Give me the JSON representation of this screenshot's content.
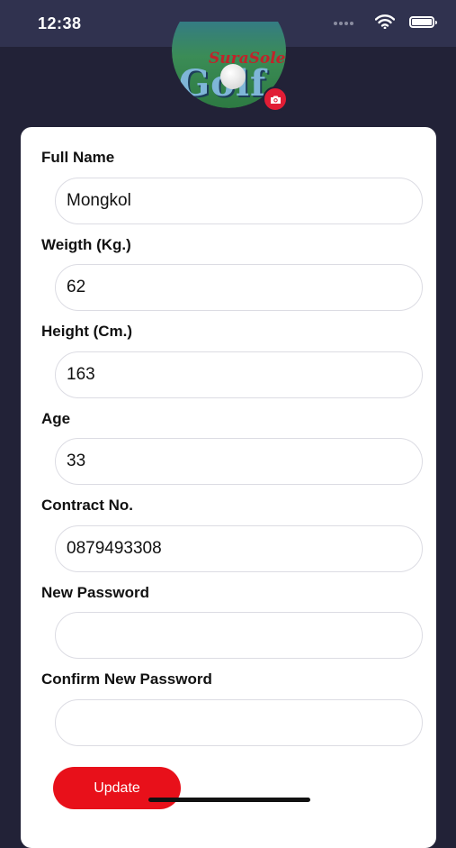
{
  "status_bar": {
    "time": "12:38"
  },
  "profile": {
    "logo_text_top": "SuraSole",
    "logo_text_main": "Golf"
  },
  "form": {
    "fields": [
      {
        "label": "Full Name",
        "value": "Mongkol"
      },
      {
        "label": "Weigth (Kg.)",
        "value": "62"
      },
      {
        "label": "Height (Cm.)",
        "value": "163"
      },
      {
        "label": "Age",
        "value": "33"
      },
      {
        "label": "Contract No.",
        "value": "0879493308"
      },
      {
        "label": "New Password",
        "value": ""
      },
      {
        "label": "Confirm New Password",
        "value": ""
      }
    ],
    "update_label": "Update"
  },
  "colors": {
    "background": "#222237",
    "status_bar": "#30324f",
    "accent": "#e8101a",
    "card": "#ffffff"
  },
  "icons": {
    "camera": "camera-icon",
    "wifi": "wifi-icon",
    "battery": "battery-icon",
    "signal": "signal-icon"
  }
}
